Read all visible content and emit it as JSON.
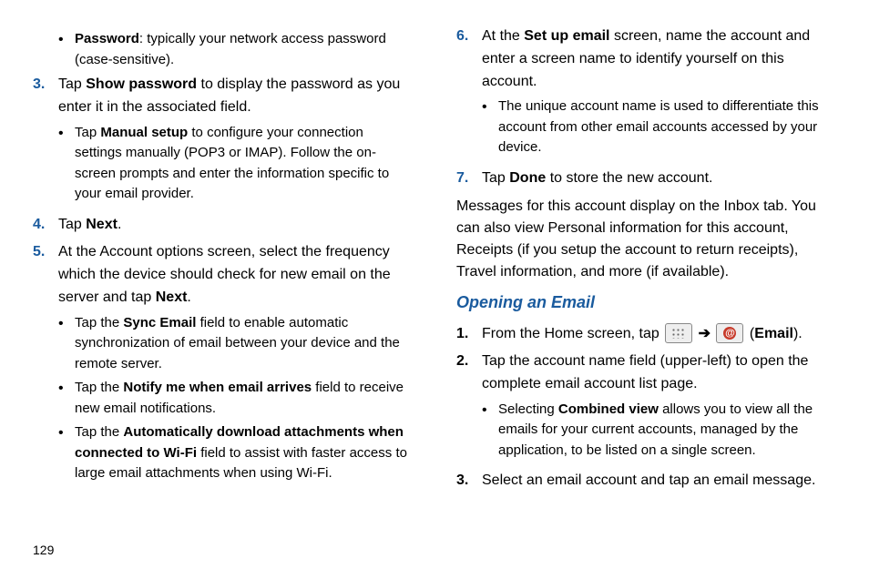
{
  "pageNumber": "129",
  "left": {
    "bullet_password_label": "Password",
    "bullet_password_text": ": typically your network access password (case-sensitive).",
    "step3_num": "3.",
    "step3_a": "Tap ",
    "step3_b": "Show password",
    "step3_c": " to display the password as you enter it in the associated field.",
    "step3_sub_a": "Tap ",
    "step3_sub_b": "Manual setup",
    "step3_sub_c": " to configure your connection settings manually (POP3 or IMAP). Follow the on-screen prompts and enter the information specific to your email provider.",
    "step4_num": "4.",
    "step4_a": "Tap ",
    "step4_b": "Next",
    "step4_c": ".",
    "step5_num": "5.",
    "step5_a": "At the Account options screen, select the frequency which the device should check for new email on the server and tap ",
    "step5_b": "Next",
    "step5_c": ".",
    "step5_s1_a": "Tap the ",
    "step5_s1_b": "Sync Email",
    "step5_s1_c": " field to enable automatic synchronization of email between your device and the remote server.",
    "step5_s2_a": "Tap the ",
    "step5_s2_b": "Notify me when email arrives",
    "step5_s2_c": " field to receive new email notifications.",
    "step5_s3_a": "Tap the ",
    "step5_s3_b": "Automatically download attachments when connected to Wi-Fi",
    "step5_s3_c": " field to assist with faster access to large email attachments when using Wi-Fi."
  },
  "right": {
    "step6_num": "6.",
    "step6_a": "At the ",
    "step6_b": "Set up email",
    "step6_c": " screen, name the account and enter a screen name to identify yourself on this account.",
    "step6_sub": "The unique account name is used to differentiate this account from other email accounts accessed by your device.",
    "step7_num": "7.",
    "step7_a": "Tap ",
    "step7_b": "Done",
    "step7_c": " to store the new account.",
    "para": "Messages for this account display on the Inbox tab. You can also view Personal information for this account, Receipts (if you setup the account to return receipts), Travel information, and more (if available).",
    "heading": "Opening an Email",
    "o1_num": "1.",
    "o1_a": "From the Home screen, tap ",
    "o1_arrow": "  ➔  ",
    "o1_paren_l": " (",
    "o1_b": "Email",
    "o1_paren_r": ").",
    "o2_num": "2.",
    "o2_a": "Tap the account name field (upper-left) to open the complete email account list page.",
    "o2_sub_a": "Selecting ",
    "o2_sub_b": "Combined view",
    "o2_sub_c": " allows you to view all the emails for your current accounts, managed by the application, to be listed on a single screen.",
    "o3_num": "3.",
    "o3_a": "Select an email account and tap an email message."
  }
}
